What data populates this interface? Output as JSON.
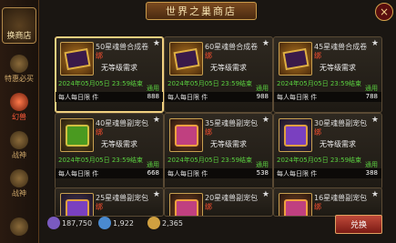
{
  "window": {
    "title": "世界之巢商店",
    "close_label": "×"
  },
  "sidebar": {
    "logo_label": "换商店",
    "items": [
      {
        "label": "特惠必买",
        "active": false
      },
      {
        "label": "幻兽",
        "active": true
      },
      {
        "label": "战神",
        "active": false
      },
      {
        "label": "战神",
        "active": false
      },
      {
        "label": "",
        "active": false
      }
    ]
  },
  "shop": {
    "items": [
      {
        "name": "50星魂兽合成卷",
        "bang": "绑",
        "requirement": "无等级需求",
        "date": "2024年05月05日 23:59结束",
        "currency": "通用",
        "limit": "每人每日限",
        "limit_suffix": "件",
        "price": "888",
        "icon": "book",
        "selected": true
      },
      {
        "name": "60星魂兽合成卷",
        "bang": "绑",
        "requirement": "无等级需求",
        "date": "2024年05月05日 23:59结束",
        "currency": "通用",
        "limit": "每人每日限",
        "limit_suffix": "件",
        "price": "988",
        "icon": "book",
        "selected": false
      },
      {
        "name": "45星魂兽合成卷",
        "bang": "绑",
        "requirement": "无等级需求",
        "date": "2024年05月05日 23:59结束",
        "currency": "通用",
        "limit": "每人每日限",
        "limit_suffix": "件",
        "price": "788",
        "icon": "book",
        "selected": false
      },
      {
        "name": "40星魂兽副宠包",
        "bang": "绑",
        "requirement": "无等级需求",
        "date": "2024年05月05日 23:59结束",
        "currency": "通用",
        "limit": "每人每日限",
        "limit_suffix": "件",
        "price": "668",
        "icon": "green",
        "selected": false
      },
      {
        "name": "35星魂兽副宠包",
        "bang": "绑",
        "requirement": "无等级需求",
        "date": "2024年05月05日 23:59结束",
        "currency": "通用",
        "limit": "每人每日限",
        "limit_suffix": "件",
        "price": "538",
        "icon": "pink",
        "selected": false
      },
      {
        "name": "30星魂兽副宠包",
        "bang": "绑",
        "requirement": "无等级需求",
        "date": "2024年05月05日 23:59结束",
        "currency": "通用",
        "limit": "每人每日限",
        "limit_suffix": "件",
        "price": "388",
        "icon": "purple",
        "selected": false
      },
      {
        "name": "25星魂兽副宠包",
        "bang": "绑",
        "requirement": "",
        "date": "",
        "currency": "",
        "limit": "",
        "limit_suffix": "",
        "price": "",
        "icon": "purple",
        "selected": false
      },
      {
        "name": "20星魂兽副宠包",
        "bang": "绑",
        "requirement": "",
        "date": "",
        "currency": "",
        "limit": "",
        "limit_suffix": "",
        "price": "",
        "icon": "pink",
        "selected": false
      },
      {
        "name": "16星魂兽副宠包",
        "bang": "绑",
        "requirement": "",
        "date": "",
        "currency": "",
        "limit": "",
        "limit_suffix": "",
        "price": "",
        "icon": "pink",
        "selected": false
      }
    ]
  },
  "wallet": {
    "currency1": "187,750",
    "currency2": "1,922",
    "currency3": "2,365",
    "exchange_label": "兑换"
  }
}
